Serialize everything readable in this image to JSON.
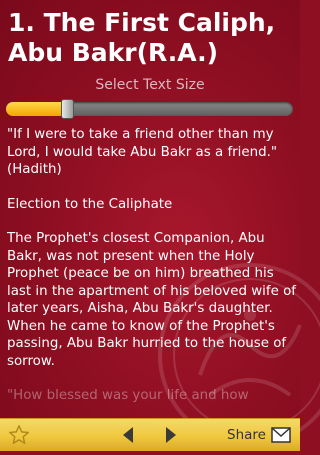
{
  "header": {
    "title": "1. The First Caliph, Abu Bakr(R.A.)"
  },
  "text_size": {
    "label": "Select Text Size",
    "level": 0.2
  },
  "content": {
    "paragraphs": [
      "\"If I were to take a friend other than my Lord, I would take Abu Bakr as a friend.\" (Hadith)",
      "Election to the Caliphate",
      "The Prophet's closest Companion, Abu Bakr, was not present when the Holy Prophet (peace be on him) breathed his last in the apartment of his beloved wife of later years, Aisha, Abu Bakr's daughter. When he came to know of the Prophet's passing, Abu Bakr hurried to the house of sorrow.",
      "\"How blessed was your life and how"
    ]
  },
  "bottom_bar": {
    "favorite_icon": "star-icon",
    "prev_icon": "arrow-left-icon",
    "next_icon": "arrow-right-icon",
    "share_label": "Share",
    "mail_icon": "envelope-icon"
  },
  "colors": {
    "background": "#8e0f22",
    "text": "#ffffff",
    "bar": "#f0c83e",
    "slider_fill": "#f3a600"
  }
}
